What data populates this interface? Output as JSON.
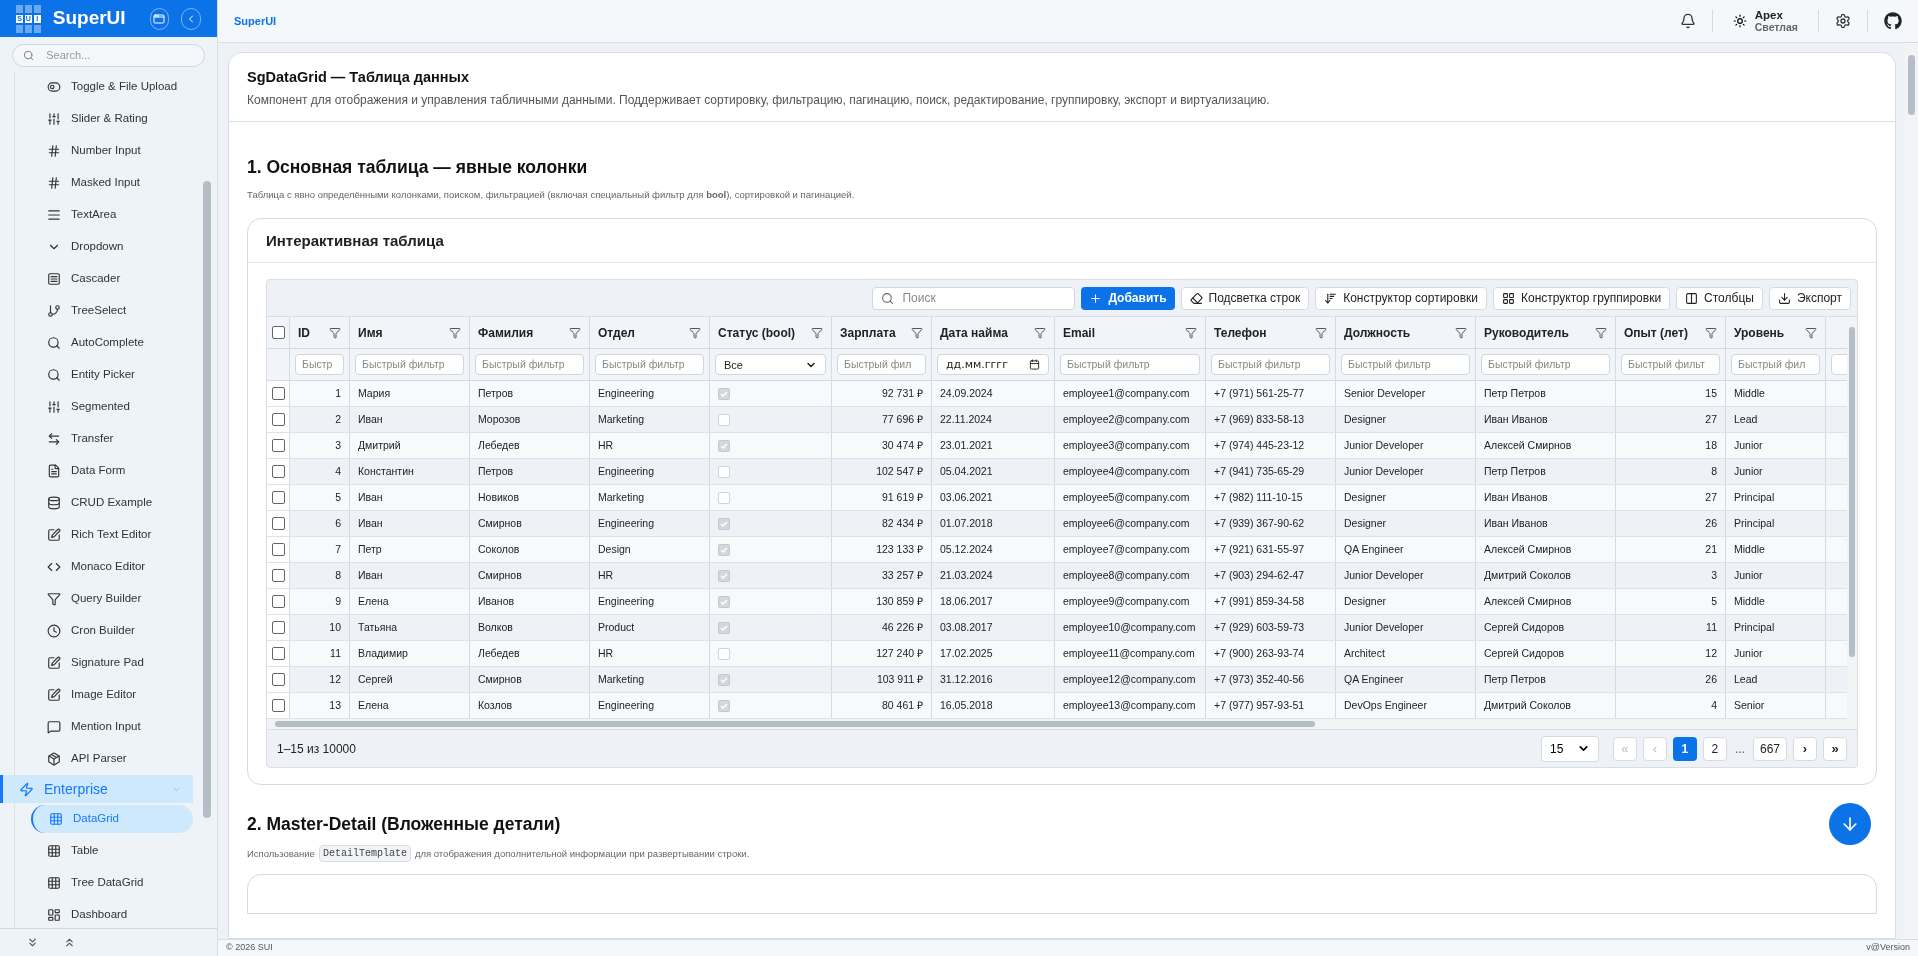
{
  "sidebar": {
    "brand": "SuperUI",
    "logo_letters": [
      "S",
      "U",
      "I"
    ],
    "search": {
      "placeholder": "Search..."
    },
    "items": [
      {
        "label": "Toggle & File Upload",
        "kind": "toggle",
        "selected": false
      },
      {
        "label": "Slider & Rating",
        "kind": "sliders",
        "selected": false
      },
      {
        "label": "Number Input",
        "kind": "hash",
        "selected": false
      },
      {
        "label": "Masked Input",
        "kind": "hash",
        "selected": false
      },
      {
        "label": "TextArea",
        "kind": "lines",
        "selected": false
      },
      {
        "label": "Dropdown",
        "kind": "chevron",
        "selected": false
      },
      {
        "label": "Cascader",
        "kind": "cascader",
        "selected": false
      },
      {
        "label": "TreeSelect",
        "kind": "branch",
        "selected": false
      },
      {
        "label": "AutoComplete",
        "kind": "search",
        "selected": false
      },
      {
        "label": "Entity Picker",
        "kind": "search",
        "selected": false
      },
      {
        "label": "Segmented",
        "kind": "sliders",
        "selected": false
      },
      {
        "label": "Transfer",
        "kind": "transfer",
        "selected": false
      },
      {
        "label": "Data Form",
        "kind": "file",
        "selected": false
      },
      {
        "label": "CRUD Example",
        "kind": "database",
        "selected": false
      },
      {
        "label": "Rich Text Editor",
        "kind": "pen",
        "selected": false
      },
      {
        "label": "Monaco Editor",
        "kind": "code",
        "selected": false
      },
      {
        "label": "Query Builder",
        "kind": "funnel",
        "selected": false
      },
      {
        "label": "Cron Builder",
        "kind": "clock",
        "selected": false
      },
      {
        "label": "Signature Pad",
        "kind": "pen",
        "selected": false
      },
      {
        "label": "Image Editor",
        "kind": "pen",
        "selected": false
      },
      {
        "label": "Mention Input",
        "kind": "message",
        "selected": false
      },
      {
        "label": "API Parser",
        "kind": "package",
        "selected": false
      }
    ],
    "group": {
      "label": "Enterprise",
      "expanded": true,
      "selected": true,
      "children": [
        {
          "label": "DataGrid",
          "kind": "grid",
          "selected": true
        },
        {
          "label": "Table",
          "kind": "grid",
          "selected": false
        },
        {
          "label": "Tree DataGrid",
          "kind": "grid",
          "selected": false
        },
        {
          "label": "Dashboard",
          "kind": "dashboard",
          "selected": false
        }
      ]
    }
  },
  "header": {
    "brand": "SuperUI",
    "theme": {
      "name": "Apex",
      "mode": "Светлая"
    }
  },
  "page": {
    "title": "SgDataGrid — Таблица данных",
    "description": "Компонент для отображения и управления табличными данными. Поддерживает сортировку, фильтрацию, пагинацию, поиск, редактирование, группировку, экспорт и виртуализацию."
  },
  "section1": {
    "heading": "1. Основная таблица — явные колонки",
    "description": "Таблица с явно определёнными колонками, поиском, фильтрацией (включая специальный фильтр для **bool**), сортировкой и пагинацией.",
    "card_title": "Интерактивная таблица"
  },
  "grid": {
    "search": {
      "placeholder": "Поиск"
    },
    "buttons": [
      {
        "label": "Добавить",
        "kind": "primary"
      },
      {
        "label": "Подсветка строк",
        "kind": "outline"
      },
      {
        "label": "Конструктор сортировки",
        "kind": "outline"
      },
      {
        "label": "Конструктор группировки",
        "kind": "outline"
      },
      {
        "label": "Столбцы",
        "kind": "outline"
      },
      {
        "label": "Экспорт",
        "kind": "outline"
      }
    ],
    "select_all": {
      "checked": false
    },
    "columns": [
      {
        "label": "ID",
        "kind": "number",
        "filter": {
          "kind": "text",
          "placeholder": "Быстр"
        }
      },
      {
        "label": "Имя",
        "kind": "text",
        "filter": {
          "kind": "text",
          "placeholder": "Быстрый фильтр"
        }
      },
      {
        "label": "Фамилия",
        "kind": "text",
        "filter": {
          "kind": "text",
          "placeholder": "Быстрый фильтр"
        }
      },
      {
        "label": "Отдел",
        "kind": "text",
        "filter": {
          "kind": "text",
          "placeholder": "Быстрый фильтр"
        }
      },
      {
        "label": "Статус (bool)",
        "kind": "bool",
        "filter": {
          "kind": "select",
          "value": "Все"
        }
      },
      {
        "label": "Зарплата",
        "kind": "number",
        "filter": {
          "kind": "text",
          "placeholder": "Быстрый фил"
        }
      },
      {
        "label": "Дата найма",
        "kind": "text",
        "filter": {
          "kind": "date",
          "placeholder": "дд.мм.гггг"
        }
      },
      {
        "label": "Email",
        "kind": "text",
        "filter": {
          "kind": "text",
          "placeholder": "Быстрый фильтр"
        }
      },
      {
        "label": "Телефон",
        "kind": "text",
        "filter": {
          "kind": "text",
          "placeholder": "Быстрый фильтр"
        }
      },
      {
        "label": "Должность",
        "kind": "text",
        "filter": {
          "kind": "text",
          "placeholder": "Быстрый фильтр"
        }
      },
      {
        "label": "Руководитель",
        "kind": "text",
        "filter": {
          "kind": "text",
          "placeholder": "Быстрый фильтр"
        }
      },
      {
        "label": "Опыт (лет)",
        "kind": "number",
        "filter": {
          "kind": "text",
          "placeholder": "Быстрый фильт"
        }
      },
      {
        "label": "Уровень",
        "kind": "text",
        "filter": {
          "kind": "text",
          "placeholder": "Быстрый фил"
        }
      }
    ],
    "rows": [
      {
        "selected": false,
        "cells": [
          "1",
          "Мария",
          "Петров",
          "Engineering",
          true,
          "92 731 ₽",
          "24.09.2024",
          "employee1@company.com",
          "+7 (971) 561-25-77",
          "Senior Developer",
          "Петр Петров",
          "15",
          "Middle"
        ]
      },
      {
        "selected": false,
        "cells": [
          "2",
          "Иван",
          "Морозов",
          "Marketing",
          false,
          "77 696 ₽",
          "22.11.2024",
          "employee2@company.com",
          "+7 (969) 833-58-13",
          "Designer",
          "Иван Иванов",
          "27",
          "Lead"
        ]
      },
      {
        "selected": false,
        "cells": [
          "3",
          "Дмитрий",
          "Лебедев",
          "HR",
          true,
          "30 474 ₽",
          "23.01.2021",
          "employee3@company.com",
          "+7 (974) 445-23-12",
          "Junior Developer",
          "Алексей Смирнов",
          "18",
          "Junior"
        ]
      },
      {
        "selected": false,
        "cells": [
          "4",
          "Константин",
          "Петров",
          "Engineering",
          false,
          "102 547 ₽",
          "05.04.2021",
          "employee4@company.com",
          "+7 (941) 735-65-29",
          "Junior Developer",
          "Петр Петров",
          "8",
          "Junior"
        ]
      },
      {
        "selected": false,
        "cells": [
          "5",
          "Иван",
          "Новиков",
          "Marketing",
          false,
          "91 619 ₽",
          "03.06.2021",
          "employee5@company.com",
          "+7 (982) 111-10-15",
          "Designer",
          "Иван Иванов",
          "27",
          "Principal"
        ]
      },
      {
        "selected": false,
        "cells": [
          "6",
          "Иван",
          "Смирнов",
          "Engineering",
          true,
          "82 434 ₽",
          "01.07.2018",
          "employee6@company.com",
          "+7 (939) 367-90-62",
          "Designer",
          "Иван Иванов",
          "26",
          "Principal"
        ]
      },
      {
        "selected": false,
        "cells": [
          "7",
          "Петр",
          "Соколов",
          "Design",
          true,
          "123 133 ₽",
          "05.12.2024",
          "employee7@company.com",
          "+7 (921) 631-55-97",
          "QA Engineer",
          "Алексей Смирнов",
          "21",
          "Middle"
        ]
      },
      {
        "selected": false,
        "cells": [
          "8",
          "Иван",
          "Смирнов",
          "HR",
          true,
          "33 257 ₽",
          "21.03.2024",
          "employee8@company.com",
          "+7 (903) 294-62-47",
          "Junior Developer",
          "Дмитрий Соколов",
          "3",
          "Junior"
        ]
      },
      {
        "selected": false,
        "cells": [
          "9",
          "Елена",
          "Иванов",
          "Engineering",
          true,
          "130 859 ₽",
          "18.06.2017",
          "employee9@company.com",
          "+7 (991) 859-34-58",
          "Designer",
          "Алексей Смирнов",
          "5",
          "Middle"
        ]
      },
      {
        "selected": false,
        "cells": [
          "10",
          "Татьяна",
          "Волков",
          "Product",
          true,
          "46 226 ₽",
          "03.08.2017",
          "employee10@company.com",
          "+7 (929) 603-59-73",
          "Junior Developer",
          "Сергей Сидоров",
          "11",
          "Principal"
        ]
      },
      {
        "selected": false,
        "cells": [
          "11",
          "Владимир",
          "Лебедев",
          "HR",
          false,
          "127 240 ₽",
          "17.02.2025",
          "employee11@company.com",
          "+7 (900) 263-93-74",
          "Architect",
          "Сергей Сидоров",
          "12",
          "Junior"
        ]
      },
      {
        "selected": false,
        "cells": [
          "12",
          "Сергей",
          "Смирнов",
          "Marketing",
          true,
          "103 911 ₽",
          "31.12.2016",
          "employee12@company.com",
          "+7 (973) 352-40-56",
          "QA Engineer",
          "Петр Петров",
          "26",
          "Lead"
        ]
      },
      {
        "selected": false,
        "cells": [
          "13",
          "Елена",
          "Козлов",
          "Engineering",
          true,
          "80 461 ₽",
          "16.05.2018",
          "employee13@company.com",
          "+7 (977) 957-93-51",
          "DevOps Engineer",
          "Дмитрий Соколов",
          "4",
          "Senior"
        ]
      }
    ],
    "summary": "1–15 из 10000",
    "page_size": "15",
    "pagination": {
      "first": {
        "label": "«",
        "disabled": true
      },
      "prev": {
        "label": "‹",
        "disabled": true
      },
      "pages": [
        {
          "kind": "page",
          "label": "1",
          "selected": true
        },
        {
          "kind": "page",
          "label": "2",
          "selected": false
        },
        {
          "kind": "ellipsis",
          "label": "..."
        },
        {
          "kind": "page",
          "label": "667",
          "selected": false
        }
      ],
      "next": {
        "label": "›",
        "disabled": false
      },
      "last": {
        "label": "»",
        "disabled": false
      }
    }
  },
  "section2": {
    "heading": "2. Master-Detail (Вложенные детали)",
    "description_before": "Использование",
    "code": "DetailTemplate",
    "description_after": "для отображения дополнительной информации при развертывании строки."
  },
  "footer": {
    "copyright": "© 2026 SUI",
    "version": "v@Version"
  }
}
